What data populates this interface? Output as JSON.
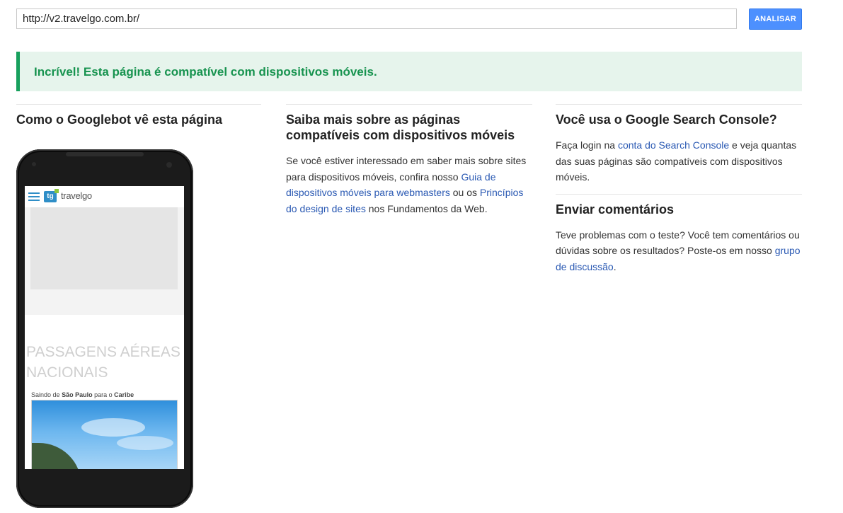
{
  "toolbar": {
    "url_value": "http://v2.travelgo.com.br/",
    "analyze_label": "ANALISAR"
  },
  "result": {
    "message": "Incrível! Esta página é compatível com dispositivos móveis."
  },
  "googlebot": {
    "title": "Como o Googlebot vê esta página",
    "preview": {
      "logo_short": "tg",
      "logo_text": "travelgo",
      "headline": "PASSAGENS AÉREAS NACIONAIS",
      "route_prefix": "Saindo de",
      "route_from": "São Paulo",
      "route_mid": "para o",
      "route_to": "Caribe"
    }
  },
  "learn_more": {
    "title": "Saiba mais sobre as páginas compatíveis com dispositivos móveis",
    "text_1": "Se você estiver interessado em saber mais sobre sites para dispositivos móveis, confira nosso ",
    "link_1": "Guia de dispositivos móveis para webmasters",
    "text_2": " ou os ",
    "link_2": "Princípios do design de sites",
    "text_3": " nos Fundamentos da Web."
  },
  "search_console": {
    "title": "Você usa o Google Search Console?",
    "text_1": "Faça login na ",
    "link": "conta do Search Console",
    "text_2": " e veja quantas das suas páginas são compatíveis com dispositivos móveis."
  },
  "feedback": {
    "title": "Enviar comentários",
    "text_1": "Teve problemas com o teste? Você tem comentários ou dúvidas sobre os resultados? Poste-os em nosso ",
    "link": "grupo de discussão",
    "text_2": "."
  },
  "colors": {
    "accent_blue": "#4d90fe",
    "success_green": "#17a05d",
    "link_blue": "#2a59b3"
  }
}
